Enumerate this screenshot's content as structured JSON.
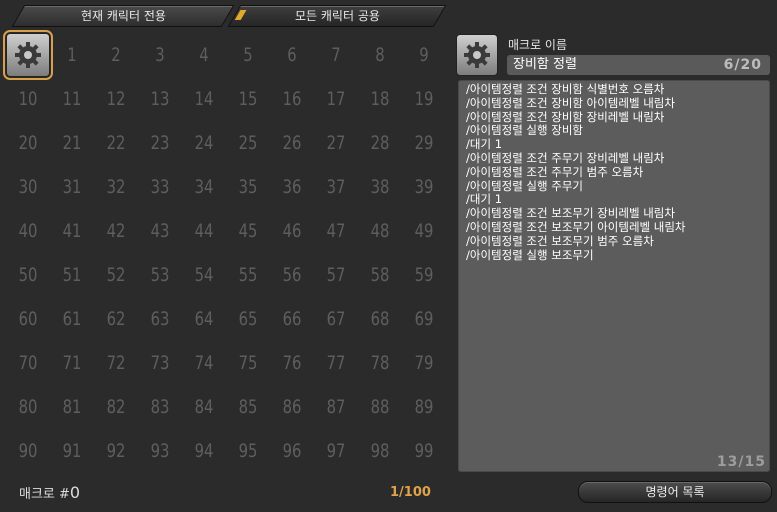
{
  "tabs": [
    {
      "label": "현재 캐릭터 전용"
    },
    {
      "label": "모든 캐릭터 공용"
    }
  ],
  "macro_grid": {
    "slots": [
      "1",
      "2",
      "3",
      "4",
      "5",
      "6",
      "7",
      "8",
      "9",
      "10",
      "11",
      "12",
      "13",
      "14",
      "15",
      "16",
      "17",
      "18",
      "19",
      "20",
      "21",
      "22",
      "23",
      "24",
      "25",
      "26",
      "27",
      "28",
      "29",
      "30",
      "31",
      "32",
      "33",
      "34",
      "35",
      "36",
      "37",
      "38",
      "39",
      "40",
      "41",
      "42",
      "43",
      "44",
      "45",
      "46",
      "47",
      "48",
      "49",
      "50",
      "51",
      "52",
      "53",
      "54",
      "55",
      "56",
      "57",
      "58",
      "59",
      "60",
      "61",
      "62",
      "63",
      "64",
      "65",
      "66",
      "67",
      "68",
      "69",
      "70",
      "71",
      "72",
      "73",
      "74",
      "75",
      "76",
      "77",
      "78",
      "79",
      "80",
      "81",
      "82",
      "83",
      "84",
      "85",
      "86",
      "87",
      "88",
      "89",
      "90",
      "91",
      "92",
      "93",
      "94",
      "95",
      "96",
      "97",
      "98",
      "99"
    ],
    "selected_slot_icon": "gear-icon"
  },
  "footer": {
    "macro_label": "매크로 #",
    "macro_index": "0",
    "page_count": "1/100",
    "command_list_button": "명령어 목록"
  },
  "editor": {
    "name_label": "매크로 이름",
    "name_value": "장비함 정렬",
    "name_counter": "6/20",
    "icon": "gear-icon",
    "lines": [
      "/아이템정렬 조건 장비함 식별번호 오름차",
      "/아이템정렬 조건 장비함 아이템레벨 내림차",
      "/아이템정렬 조건 장비함 장비레벨 내림차",
      "/아이템정렬 실행 장비함",
      "/대기 1",
      "/아이템정렬 조건 주무기 장비레벨 내림차",
      "/아이템정렬 조건 주무기 범주 오름차",
      "/아이템정렬 실행 주무기",
      "/대기 1",
      "/아이템정렬 조건 보조무기 장비레벨 내림차",
      "/아이템정렬 조건 보조무기 아이템레벨 내림차",
      "/아이템정렬 조건 보조무기 범주 오름차",
      "/아이템정렬 실행 보조무기"
    ],
    "line_counter": "13/15"
  },
  "colors": {
    "accent": "#d9a04a",
    "background": "#2b2b2b"
  }
}
